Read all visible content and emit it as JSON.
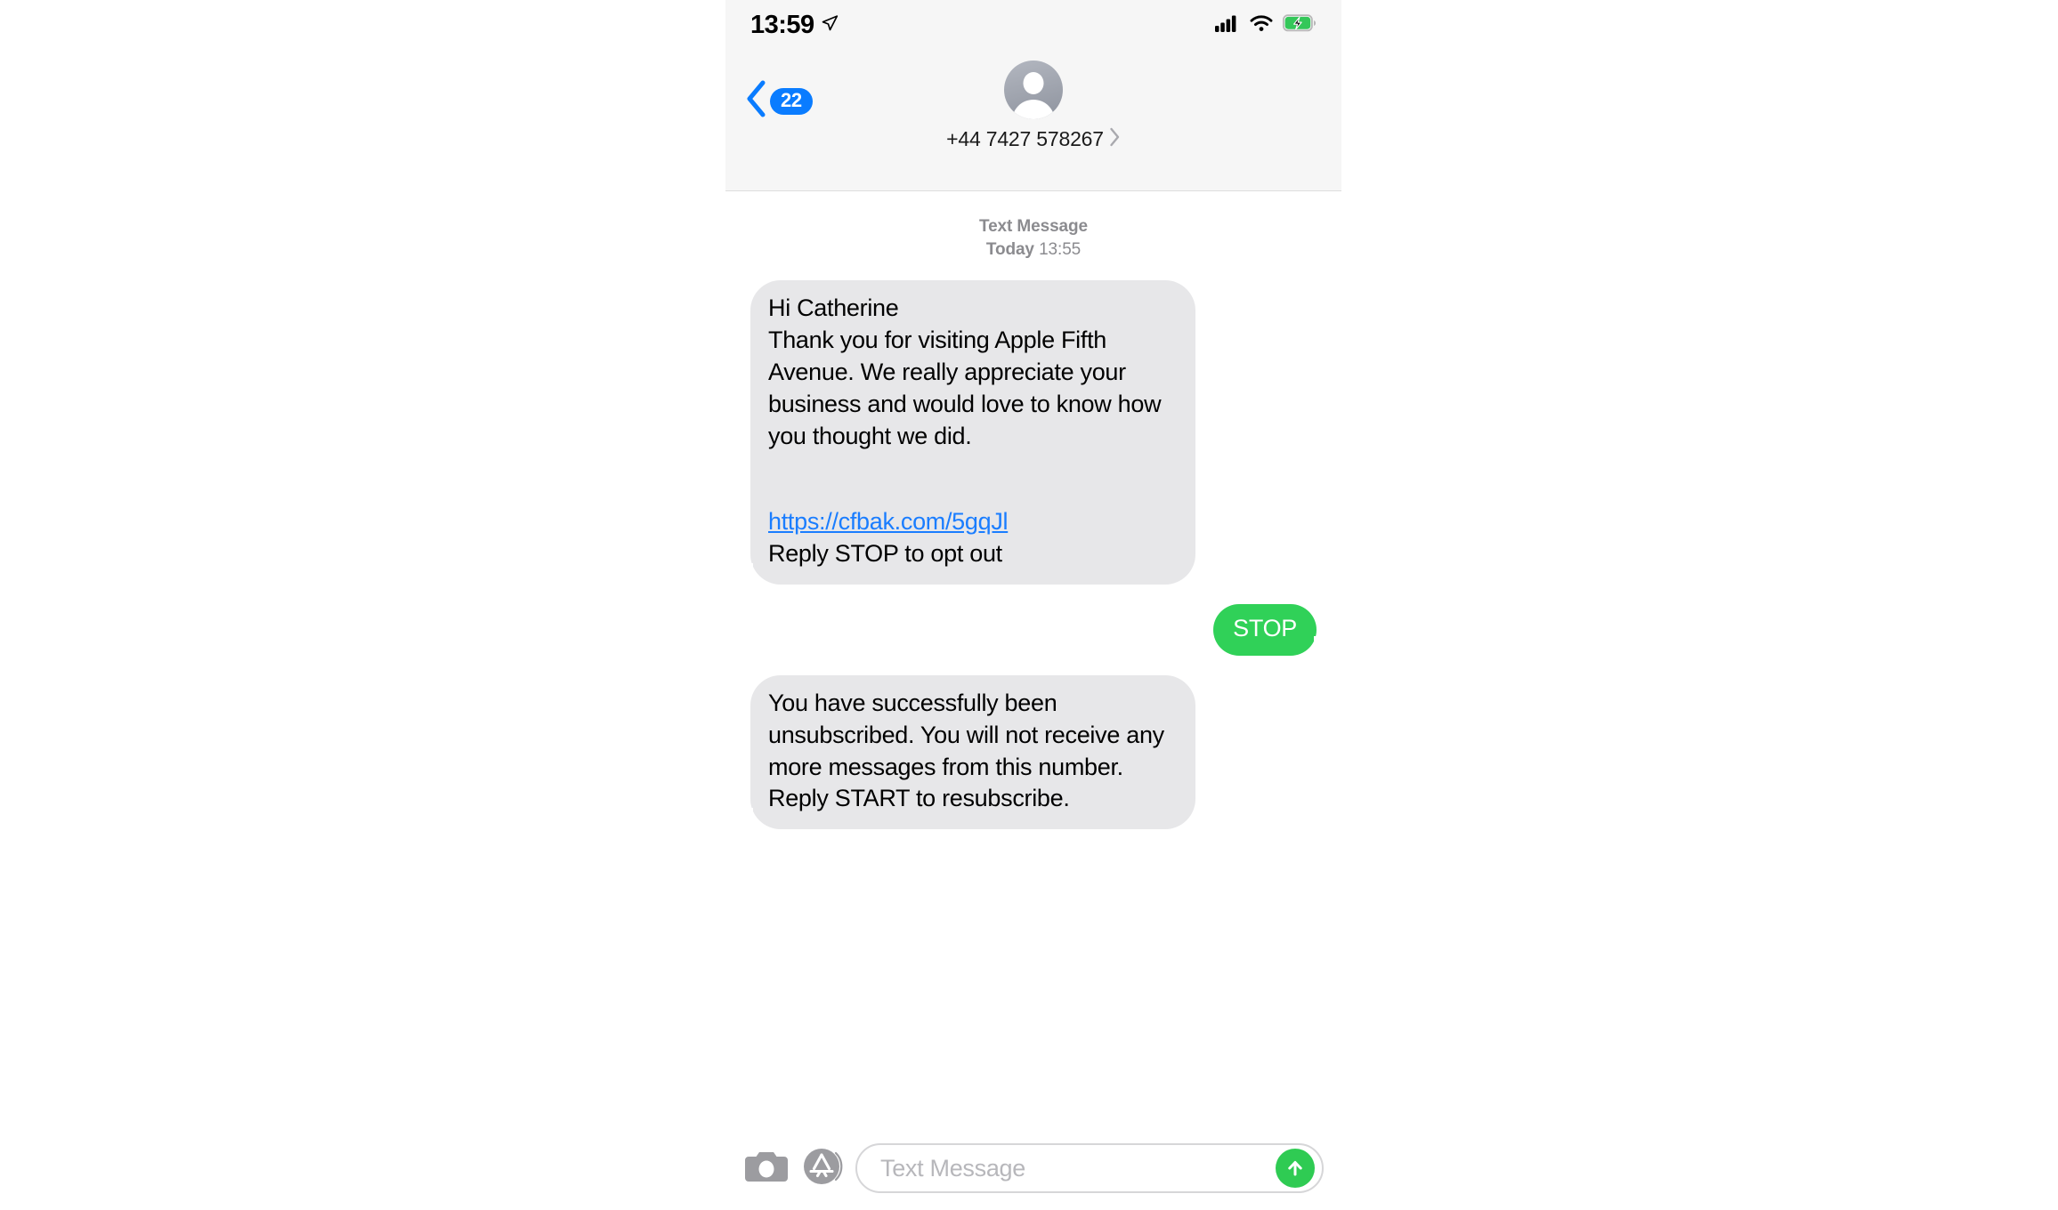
{
  "status_bar": {
    "time": "13:59",
    "location_icon": "location-arrow-icon",
    "signal_icon": "cellular-signal-icon",
    "wifi_icon": "wifi-icon",
    "battery_icon": "battery-charging-icon",
    "battery_color": "#34c759"
  },
  "nav": {
    "back_badge": "22",
    "back_icon": "chevron-left-icon",
    "accent_color": "#0a7cff",
    "avatar_icon": "person-avatar-icon",
    "contact_name": "+44 7427 578267",
    "contact_chevron_icon": "chevron-right-icon"
  },
  "conversation": {
    "timestamp_kind": "Text Message",
    "timestamp_day": "Today",
    "timestamp_time": "13:55",
    "messages": [
      {
        "direction": "incoming",
        "text_before_link": "Hi Catherine\nThank you for visiting Apple Fifth Avenue. We really appreciate your business and would love to know how you thought we did.",
        "link": "https://cfbak.com/5gqJl",
        "text_after_link": "Reply STOP to opt out"
      },
      {
        "direction": "outgoing",
        "text": "STOP"
      },
      {
        "direction": "incoming",
        "text": "You have successfully been unsubscribed. You will not receive any more messages from this number. Reply START to resubscribe."
      }
    ],
    "incoming_bubble_color": "#e7e7e9",
    "outgoing_bubble_color": "#30d158",
    "link_color": "#1a7dff"
  },
  "toolbar": {
    "camera_icon": "camera-icon",
    "appstore_icon": "app-store-icon",
    "input_placeholder": "Text Message",
    "input_value": "",
    "send_icon": "send-arrow-up-icon",
    "send_color": "#2fcb53"
  }
}
